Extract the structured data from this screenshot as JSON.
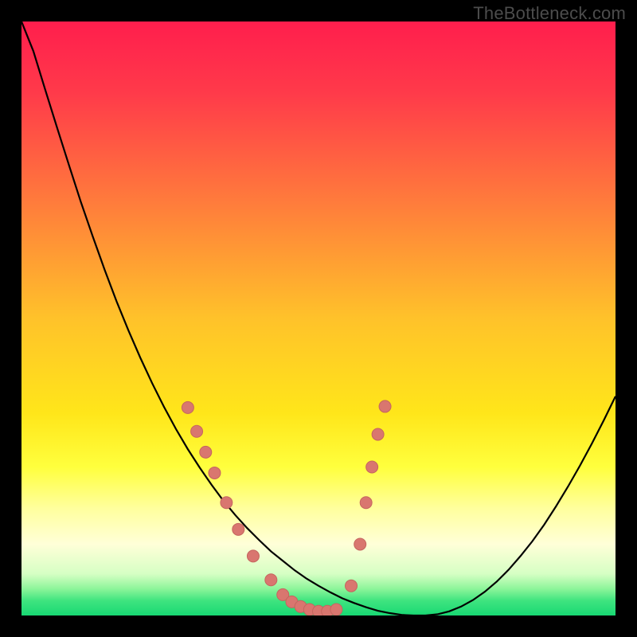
{
  "watermark": "TheBottleneck.com",
  "colors": {
    "frame": "#000000",
    "curve": "#000000",
    "marker_fill": "#d9766f",
    "marker_stroke": "#c5655e",
    "gradient_stops": [
      {
        "offset": 0,
        "color": "#ff1e4d"
      },
      {
        "offset": 0.12,
        "color": "#ff3a4a"
      },
      {
        "offset": 0.3,
        "color": "#ff7a3c"
      },
      {
        "offset": 0.5,
        "color": "#ffc22a"
      },
      {
        "offset": 0.66,
        "color": "#ffe61a"
      },
      {
        "offset": 0.75,
        "color": "#ffff3d"
      },
      {
        "offset": 0.82,
        "color": "#ffff9e"
      },
      {
        "offset": 0.88,
        "color": "#ffffd8"
      },
      {
        "offset": 0.93,
        "color": "#d6ffc4"
      },
      {
        "offset": 0.955,
        "color": "#8df59a"
      },
      {
        "offset": 0.975,
        "color": "#3fe47f"
      },
      {
        "offset": 1.0,
        "color": "#18d873"
      }
    ]
  },
  "chart_data": {
    "type": "line",
    "title": "",
    "xlabel": "",
    "ylabel": "",
    "xlim": [
      0,
      100
    ],
    "ylim": [
      0,
      100
    ],
    "x": [
      0,
      2,
      4,
      6,
      8,
      10,
      12,
      14,
      16,
      18,
      20,
      22,
      24,
      26,
      28,
      30,
      32,
      34,
      36,
      38,
      40,
      42,
      44,
      46,
      48,
      50,
      52,
      54,
      56,
      58,
      60,
      62,
      64,
      66,
      68,
      70,
      72,
      74,
      76,
      78,
      80,
      82,
      84,
      86,
      88,
      90,
      92,
      94,
      96,
      98,
      100
    ],
    "series": [
      {
        "name": "bottleneck-curve",
        "values": [
          100,
          95.0,
          88.5,
          82.1,
          75.8,
          69.6,
          63.8,
          58.2,
          52.9,
          48.0,
          43.4,
          39.1,
          35.1,
          31.4,
          28.0,
          24.9,
          22.0,
          19.3,
          16.9,
          14.7,
          12.7,
          10.8,
          9.2,
          7.6,
          6.2,
          5.0,
          3.9,
          2.9,
          2.1,
          1.4,
          0.8,
          0.4,
          0.1,
          0.0,
          0.0,
          0.2,
          0.7,
          1.5,
          2.6,
          4.0,
          5.7,
          7.7,
          10.0,
          12.5,
          15.3,
          18.4,
          21.7,
          25.2,
          28.9,
          32.8,
          36.9
        ]
      }
    ],
    "markers": {
      "name": "highlight-points",
      "x": [
        28.0,
        29.5,
        31.0,
        32.5,
        34.5,
        36.5,
        39.0,
        42.0,
        44.0,
        45.5,
        47.0,
        48.5,
        50.0,
        51.5,
        53.0,
        55.5,
        57.0,
        58.0,
        59.0,
        60.0,
        61.2
      ],
      "y": [
        35.0,
        31.0,
        27.5,
        24.0,
        19.0,
        14.5,
        10.0,
        6.0,
        3.5,
        2.3,
        1.5,
        1.0,
        0.7,
        0.7,
        1.0,
        5.0,
        12.0,
        19.0,
        25.0,
        30.5,
        35.2
      ]
    }
  }
}
